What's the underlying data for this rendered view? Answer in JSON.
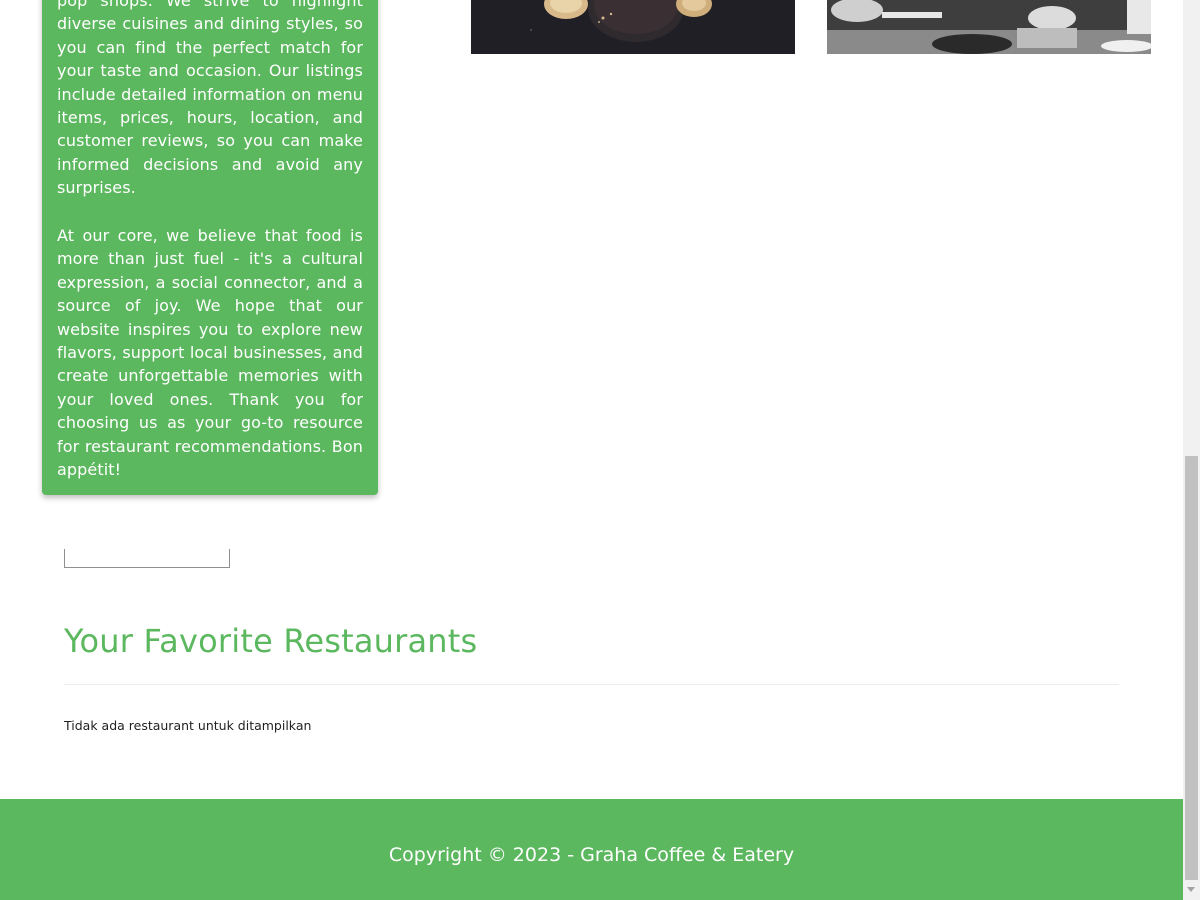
{
  "about": {
    "paragraph1": "pop shops. We strive to highlight diverse cuisines and dining styles, so you can find the perfect match for your taste and occasion. Our listings include detailed information on menu items, prices, hours, location, and customer reviews, so you can make informed decisions and avoid any surprises.",
    "paragraph2": "At our core, we believe that food is more than just fuel - it's a cultural expression, a social connector, and a source of joy. We hope that our website inspires you to explore new flavors, support local businesses, and create unforgettable memories with your loved ones. Thank you for choosing us as your go-to resource for restaurant recommendations. Bon appétit!"
  },
  "search": {
    "value": "",
    "placeholder": ""
  },
  "favorites": {
    "title": "Your Favorite Restaurants",
    "empty_message": "Tidak ada restaurant untuk ditampilkan"
  },
  "footer": {
    "copyright": "Copyright © 2023 - Graha Coffee & Eatery"
  },
  "colors": {
    "accent": "#5cb85f",
    "footer_text": "#ffffff"
  }
}
